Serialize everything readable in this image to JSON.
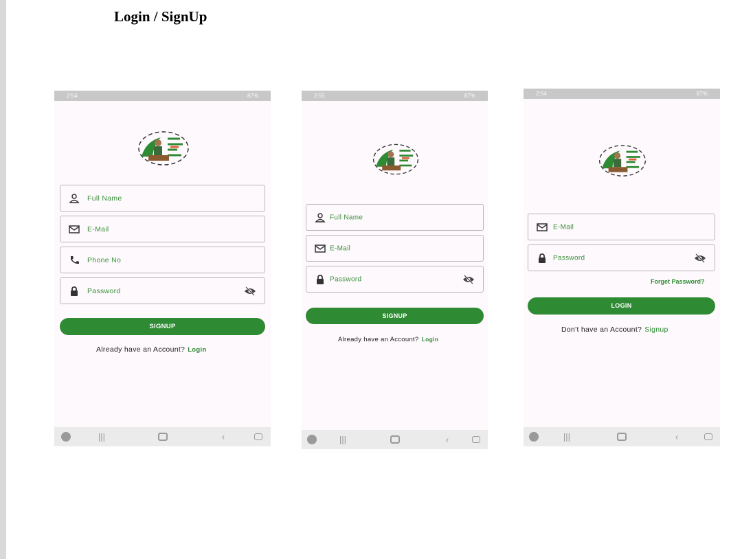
{
  "document": {
    "title": "Login / SignUp"
  },
  "screens": [
    {
      "status": {
        "time": "2:54",
        "right": "87%"
      },
      "fields": {
        "full_name": "Full Name",
        "email": "E-Mail",
        "phone": "Phone No",
        "password": "Password"
      },
      "button": "SIGNUP",
      "alt_text": "Already have an Account?",
      "alt_link": "Login"
    },
    {
      "status": {
        "time": "2:55",
        "right": "87%"
      },
      "fields": {
        "full_name": "Full Name",
        "email": "E-Mail",
        "password": "Password"
      },
      "button": "SIGNUP",
      "alt_text": "Already have an Account?",
      "alt_link": "Login"
    },
    {
      "status": {
        "time": "2:54",
        "right": "87%"
      },
      "fields": {
        "email": "E-Mail",
        "password": "Password"
      },
      "forgot": "Forget Password?",
      "button": "LOGIN",
      "alt_text": "Don't have an Account?",
      "alt_link": "Signup"
    }
  ],
  "colors": {
    "accent": "#2f8a34",
    "label": "#3b8f3b",
    "background": "#fdf9fc"
  },
  "icons": [
    "user-icon",
    "mail-icon",
    "phone-icon",
    "lock-icon",
    "eye-off-icon",
    "farmer-logo-icon"
  ]
}
